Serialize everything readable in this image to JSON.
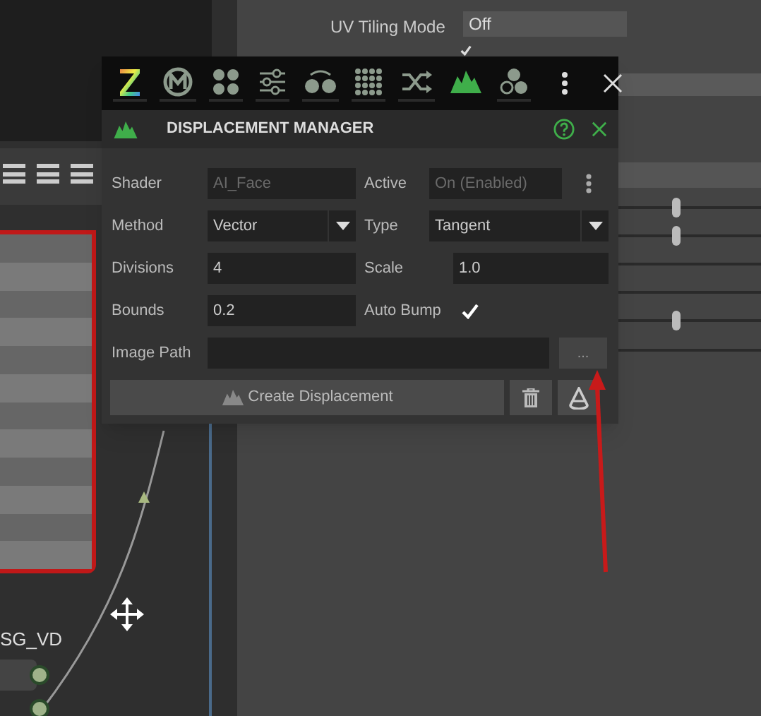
{
  "background": {
    "uv_tiling_label": "UV Tiling Mode",
    "uv_tiling_value": "Off",
    "ignore_checked": true,
    "node_label": "SG_VD"
  },
  "toolbar": [
    {
      "kind": "z-logo",
      "selected": false
    },
    {
      "kind": "m-circle",
      "selected": false
    },
    {
      "kind": "four-dots",
      "selected": false
    },
    {
      "kind": "sliders",
      "selected": false
    },
    {
      "kind": "swap-dots",
      "selected": false
    },
    {
      "kind": "grid",
      "selected": false
    },
    {
      "kind": "shuffle",
      "selected": false
    },
    {
      "kind": "mountain",
      "selected": true
    },
    {
      "kind": "three-circles",
      "selected": false
    }
  ],
  "panel": {
    "title": "DISPLACEMENT MANAGER",
    "shader": {
      "label": "Shader",
      "value": "AI_Face",
      "disabled": true
    },
    "active": {
      "label": "Active",
      "value": "On (Enabled)",
      "disabled": true
    },
    "method": {
      "label": "Method",
      "value": "Vector"
    },
    "type": {
      "label": "Type",
      "value": "Tangent"
    },
    "divisions": {
      "label": "Divisions",
      "value": "4"
    },
    "scale": {
      "label": "Scale",
      "value": "1.0"
    },
    "bounds": {
      "label": "Bounds",
      "value": "0.2"
    },
    "auto_bump": {
      "label": "Auto Bump",
      "checked": true
    },
    "image_path": {
      "label": "Image Path"
    },
    "browse_button": "...",
    "create_button": "Create Displacement"
  }
}
